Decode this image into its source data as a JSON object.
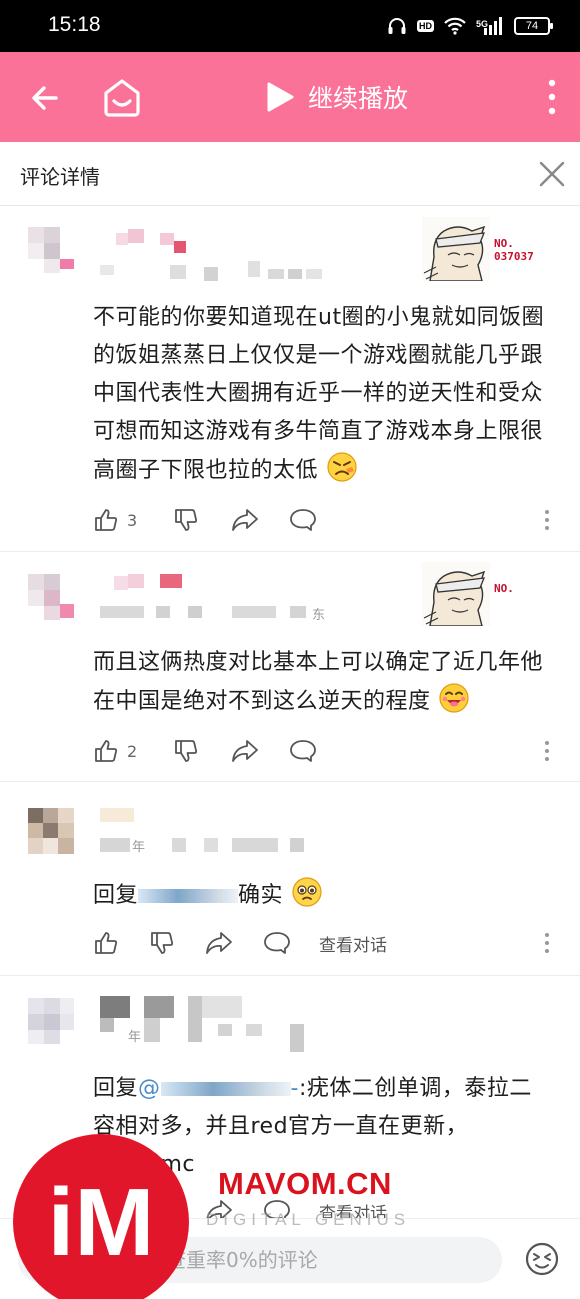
{
  "status_bar": {
    "time": "15:18",
    "network": "5G",
    "hd": "HD",
    "battery": "74",
    "icons": [
      "headphones-icon",
      "hd-icon",
      "wifi-icon",
      "signal-icon",
      "battery-icon"
    ]
  },
  "toolbar": {
    "continue_play": "继续播放",
    "background_color": "#fb7299",
    "icons": [
      "back-arrow-icon",
      "home-tv-icon",
      "play-icon",
      "more-vertical-icon"
    ]
  },
  "detail_header": {
    "title": "评论详情",
    "close_icon": "close-icon"
  },
  "comments": [
    {
      "badge_no": "NO.\n037037",
      "text": "不可能的你要知道现在ut圈的小鬼就如同饭圈的饭姐蒸蒸日上仅仅是一个游戏圈就能几乎跟中国代表性大圈拥有近乎一样的逆天性和受众可想而知这游戏有多牛简直了游戏本身上限很高圈子下限也拉的太低",
      "likes": "3"
    },
    {
      "badge_no": "NO.",
      "meta_fragment": "东",
      "text": "而且这俩热度对比基本上可以确定了近几年他在中国是绝对不到这么逆天的程度",
      "likes": "2"
    },
    {
      "meta_fragment": "年",
      "reply_prefix": "回复",
      "reply_suffix": "确实",
      "view_conversation": "查看对话"
    },
    {
      "meta_fragment": "年",
      "reply_prefix": "回复",
      "mention_start": "@",
      "mention_end": "-",
      "text_line1": ":疣体二创单调，泰拉二",
      "text_line2": "容相对多，并且red官方一直在更新，",
      "text_line3": "接近了mc",
      "view_conversation": "查看对话"
    }
  ],
  "input_bar": {
    "placeholder_visible": "条查重率0%的评论",
    "emoji_icon": "emoji-icon"
  },
  "watermark": {
    "logo_text": "iM",
    "site": "MAVOM.CN",
    "tagline": "DIGITAL GENIUS"
  }
}
